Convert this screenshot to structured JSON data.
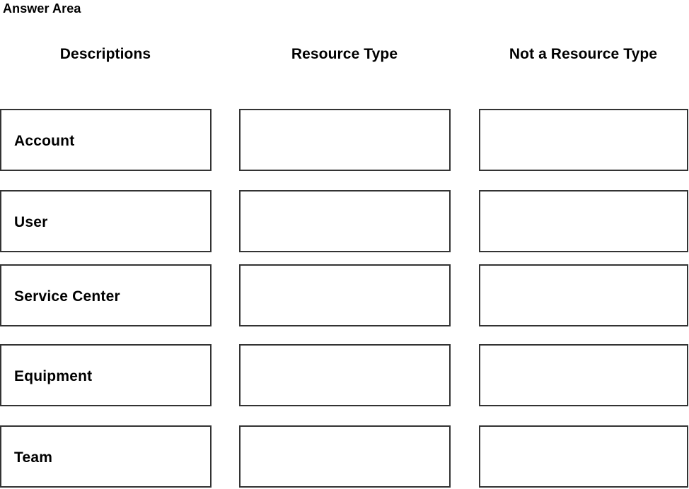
{
  "page": {
    "title": "Answer Area"
  },
  "columns": {
    "descriptions_header": "Descriptions",
    "resource_type_header": "Resource Type",
    "not_a_resource_type_header": "Not a Resource Type"
  },
  "rows": [
    {
      "description": "Account"
    },
    {
      "description": "User"
    },
    {
      "description": "Service Center"
    },
    {
      "description": "Equipment"
    },
    {
      "description": "Team"
    }
  ],
  "style": {
    "box_border_color": "#333333",
    "box_fill_color": "#FFFFFF",
    "text_color": "#000000",
    "page_background": "#FFFFFF"
  }
}
